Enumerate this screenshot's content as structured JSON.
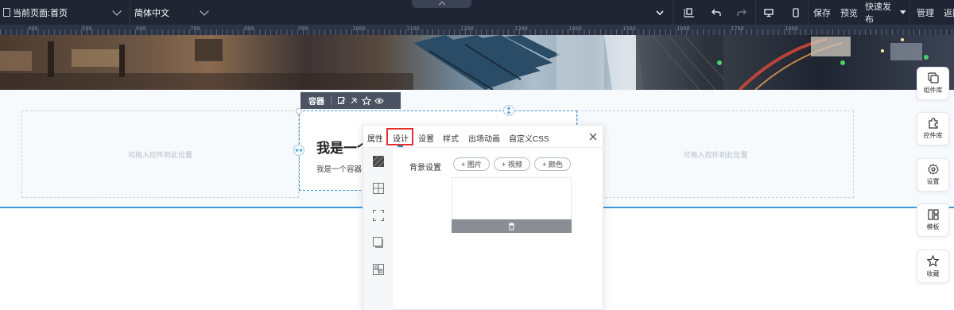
{
  "topbar": {
    "page_select": "当前页面:首页",
    "lang_select": "简体中文",
    "save": "保存",
    "preview": "预览",
    "quick_publish": "快速发布",
    "manage": "管理",
    "back": "返回"
  },
  "ruler": {
    "labels": [
      "400",
      "500",
      "600",
      "700",
      "800",
      "900",
      "1000",
      "1100",
      "1200",
      "1300",
      "1400",
      "1500",
      "1600",
      "1700",
      "1800"
    ]
  },
  "canvas": {
    "drop_left": "可拖入控件到此位置",
    "drop_right": "可拖入控件到此位置",
    "container_title": "我是一个",
    "container_text": "我是一个容器"
  },
  "container_toolbar": {
    "label": "容器"
  },
  "panel": {
    "tabs": [
      "属性",
      "设计",
      "设置",
      "样式",
      "出场动画",
      "自定义CSS"
    ],
    "active_tab": "设计",
    "bg_label": "背景设置",
    "btn_image": "+ 图片",
    "btn_video": "+ 视频",
    "btn_color": "+ 颜色"
  },
  "rail": {
    "components": "组件库",
    "controls": "控件库",
    "settings": "设置",
    "templates": "模板",
    "favorites": "收藏"
  },
  "colors": {
    "topbar": "#1f2533",
    "accent": "#3b9bd8",
    "highlight": "#e23030"
  }
}
